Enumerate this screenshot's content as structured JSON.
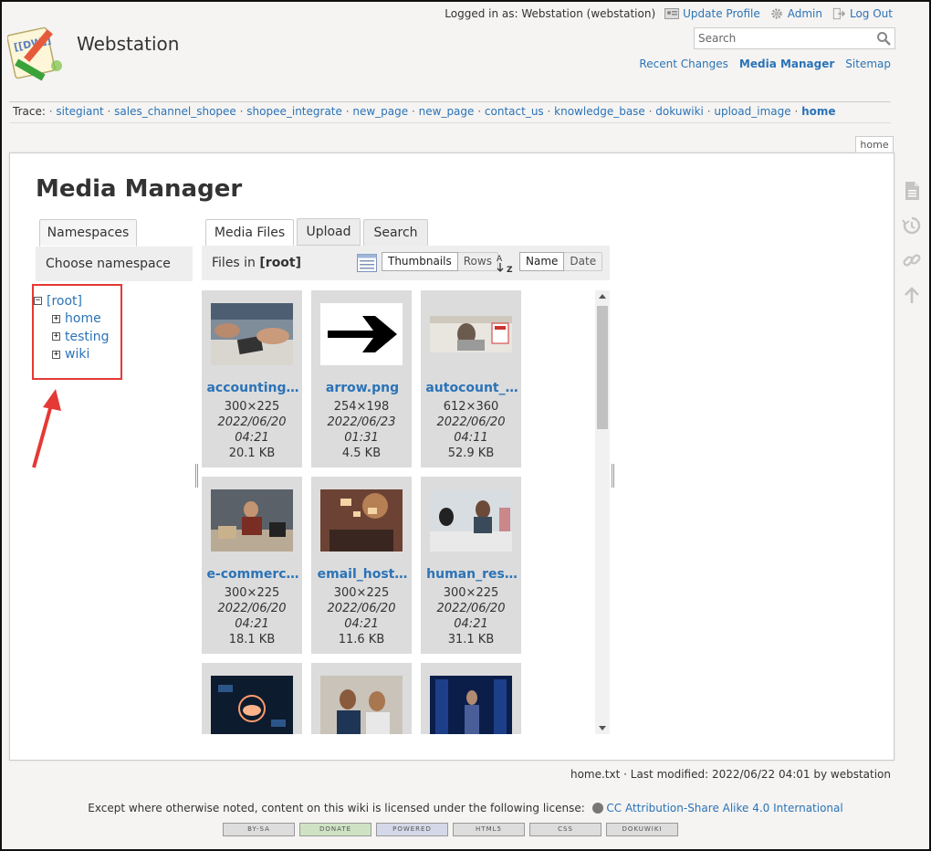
{
  "site": {
    "title": "Webstation"
  },
  "user_bar": {
    "logged_in": "Logged in as: Webstation (webstation)",
    "update_profile": "Update Profile",
    "admin": "Admin",
    "logout": "Log Out"
  },
  "search": {
    "placeholder": "Search"
  },
  "site_nav": {
    "recent": "Recent Changes",
    "media": "Media Manager",
    "sitemap": "Sitemap"
  },
  "trace": {
    "label": "Trace:",
    "items": [
      "sitegiant",
      "sales_channel_shopee",
      "shopee_integrate",
      "new_page",
      "new_page",
      "contact_us",
      "knowledge_base",
      "dokuwiki",
      "upload_image",
      "home"
    ]
  },
  "page": {
    "tab": "home",
    "title": "Media Manager"
  },
  "namespaces": {
    "tab": "Namespaces",
    "heading": "Choose namespace",
    "root": "[root]",
    "children": [
      "home",
      "testing",
      "wiki"
    ]
  },
  "media": {
    "tabs": {
      "files": "Media Files",
      "upload": "Upload",
      "search": "Search"
    },
    "files_in_label": "Files in",
    "files_in_ns": "[root]",
    "view": {
      "thumbnails": "Thumbnails",
      "rows": "Rows"
    },
    "sort": {
      "name": "Name",
      "date": "Date"
    },
    "files": [
      {
        "name": "accounting…",
        "dim": "300×225",
        "date": "2022/06/20",
        "time": "04:21",
        "size": "20.1 KB"
      },
      {
        "name": "arrow.png",
        "dim": "254×198",
        "date": "2022/06/23",
        "time": "01:31",
        "size": "4.5 KB"
      },
      {
        "name": "autocount_…",
        "dim": "612×360",
        "date": "2022/06/20",
        "time": "04:11",
        "size": "52.9 KB"
      },
      {
        "name": "e-commerc…",
        "dim": "300×225",
        "date": "2022/06/20",
        "time": "04:21",
        "size": "18.1 KB"
      },
      {
        "name": "email_host…",
        "dim": "300×225",
        "date": "2022/06/20",
        "time": "04:21",
        "size": "11.6 KB"
      },
      {
        "name": "human_res…",
        "dim": "300×225",
        "date": "2022/06/20",
        "time": "04:21",
        "size": "31.1 KB"
      },
      {
        "name": "",
        "dim": "",
        "date": "",
        "time": "",
        "size": ""
      },
      {
        "name": "",
        "dim": "",
        "date": "",
        "time": "",
        "size": ""
      },
      {
        "name": "",
        "dim": "",
        "date": "",
        "time": "",
        "size": ""
      }
    ]
  },
  "footer": {
    "docinfo": "home.txt · Last modified: 2022/06/22 04:01 by webstation",
    "license_text": "Except where otherwise noted, content on this wiki is licensed under the following license:",
    "license_link": "CC Attribution-Share Alike 4.0 International",
    "buttons": [
      "BY-SA",
      "DONATE",
      "POWERED",
      "HTML5",
      "CSS",
      "DOKUWIKI"
    ]
  },
  "colors": {
    "link": "#2b73b7",
    "annotation": "#e53935"
  }
}
